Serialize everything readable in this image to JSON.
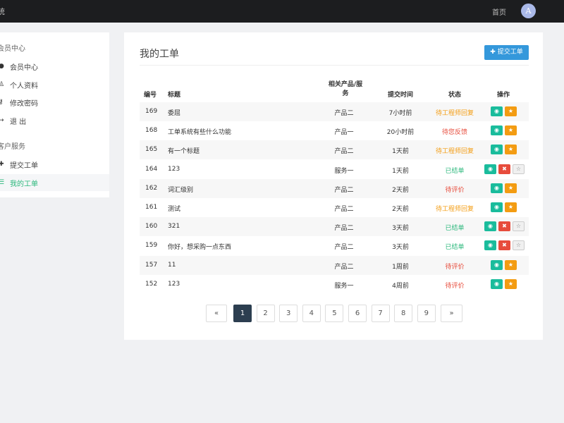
{
  "header": {
    "brand": "统",
    "home_link": "首页",
    "avatar_letter": "A"
  },
  "sidebar": {
    "groups": [
      {
        "title": "会员中心",
        "items": [
          {
            "icon": "user-circle-icon",
            "glyph": "●",
            "label": "会员中心"
          },
          {
            "icon": "user-icon",
            "glyph": "♙",
            "label": "个人资料"
          },
          {
            "icon": "key-icon",
            "glyph": "⚷",
            "label": "修改密码"
          },
          {
            "icon": "sign-out-icon",
            "glyph": "↦",
            "label": "退 出"
          }
        ]
      },
      {
        "title": "客户服务",
        "items": [
          {
            "icon": "plus-icon",
            "glyph": "✚",
            "label": "提交工单"
          },
          {
            "icon": "list-icon",
            "glyph": "☰",
            "label": "我的工单",
            "active": true
          }
        ]
      }
    ]
  },
  "main": {
    "title": "我的工单",
    "submit_button": "✚ 提交工单",
    "columns": {
      "id": "编号",
      "title": "标题",
      "product": "相关产品/服务",
      "time": "提交时间",
      "status": "状态",
      "actions": "操作"
    },
    "rows": [
      {
        "id": "169",
        "title": "委屈",
        "product": "产品二",
        "time": "7小时前",
        "status": "待工程师回复",
        "status_color": "#f39c12",
        "actions": [
          "view",
          "star"
        ]
      },
      {
        "id": "168",
        "title": "工单系统有些什么功能",
        "product": "产品一",
        "time": "20小时前",
        "status": "待您反馈",
        "status_color": "#e74c3c",
        "actions": [
          "view",
          "star"
        ]
      },
      {
        "id": "165",
        "title": "有一个标题",
        "product": "产品二",
        "time": "1天前",
        "status": "待工程师回复",
        "status_color": "#f39c12",
        "actions": [
          "view",
          "star"
        ]
      },
      {
        "id": "164",
        "title": "123",
        "product": "服务一",
        "time": "1天前",
        "status": "已结单",
        "status_color": "#2db87d",
        "actions": [
          "view",
          "delete",
          "star-outline"
        ]
      },
      {
        "id": "162",
        "title": "词汇级别",
        "product": "产品二",
        "time": "2天前",
        "status": "待评价",
        "status_color": "#e74c3c",
        "actions": [
          "view",
          "star"
        ]
      },
      {
        "id": "161",
        "title": "测试",
        "product": "产品二",
        "time": "2天前",
        "status": "待工程师回复",
        "status_color": "#f39c12",
        "actions": [
          "view",
          "star"
        ]
      },
      {
        "id": "160",
        "title": "321",
        "product": "产品二",
        "time": "3天前",
        "status": "已结单",
        "status_color": "#2db87d",
        "actions": [
          "view",
          "delete",
          "star-outline"
        ]
      },
      {
        "id": "159",
        "title": "你好，想采购一点东西",
        "product": "产品二",
        "time": "3天前",
        "status": "已结单",
        "status_color": "#2db87d",
        "actions": [
          "view",
          "delete",
          "star-outline"
        ]
      },
      {
        "id": "157",
        "title": "11",
        "product": "产品二",
        "time": "1周前",
        "status": "待评价",
        "status_color": "#e74c3c",
        "actions": [
          "view",
          "star"
        ]
      },
      {
        "id": "152",
        "title": "123",
        "product": "服务一",
        "time": "4周前",
        "status": "待评价",
        "status_color": "#e74c3c",
        "actions": [
          "view",
          "star"
        ]
      }
    ]
  },
  "pagination": {
    "prev": "«",
    "next": "»",
    "pages": [
      "1",
      "2",
      "3",
      "4",
      "5",
      "6",
      "7",
      "8",
      "9"
    ],
    "current": "1"
  }
}
